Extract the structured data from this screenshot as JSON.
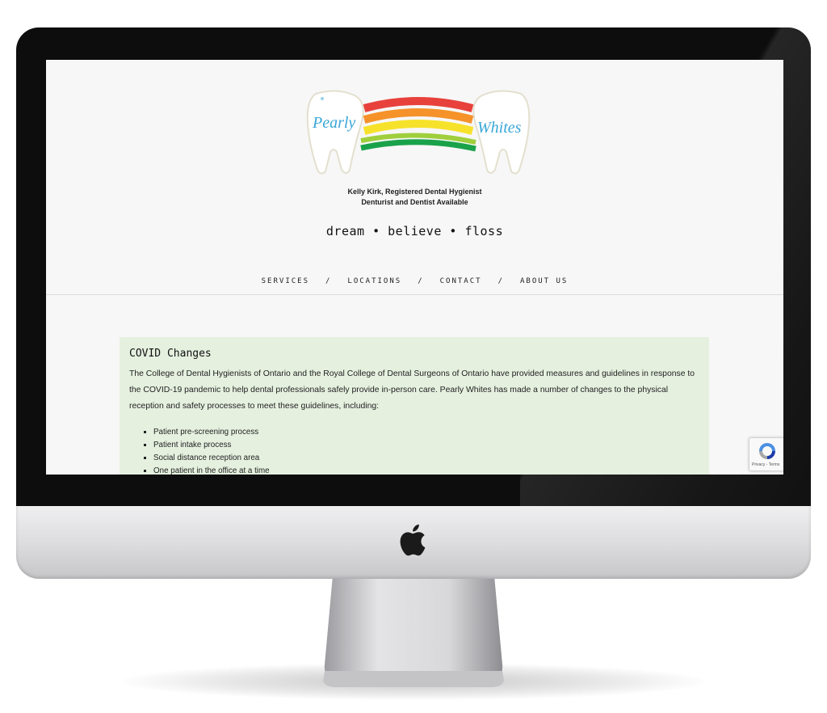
{
  "logo": {
    "word1": "Pearly",
    "word2": "Whites"
  },
  "header": {
    "tagline_line1": "Kelly Kirk, Registered Dental Hygienist",
    "tagline_line2": "Denturist and Dentist Available",
    "motto": "dream • believe • floss"
  },
  "nav": {
    "items": [
      "SERVICES",
      "LOCATIONS",
      "CONTACT",
      "ABOUT US"
    ],
    "separator": "/"
  },
  "notice": {
    "title": "COVID Changes",
    "body": "The College of Dental Hygienists of Ontario and the Royal College of Dental Surgeons of Ontario have provided measures and guidelines in response to the COVID-19 pandemic to help dental professionals safely provide in-person care. Pearly Whites has made a number of changes to the physical reception and safety processes to meet these guidelines, including:",
    "list": [
      "Patient pre-screening process",
      "Patient intake process",
      "Social distance reception area",
      "One patient in the office at a time"
    ]
  },
  "recaptcha": {
    "links": "Privacy - Terms"
  },
  "colors": {
    "rainbow": [
      "#e8413c",
      "#f5922a",
      "#f7e22b",
      "#9fcf3c",
      "#1aa24b"
    ],
    "logo_text": "#3aa7d8",
    "notice_bg": "#e5f0df",
    "page_bg": "#f7f7f7"
  }
}
